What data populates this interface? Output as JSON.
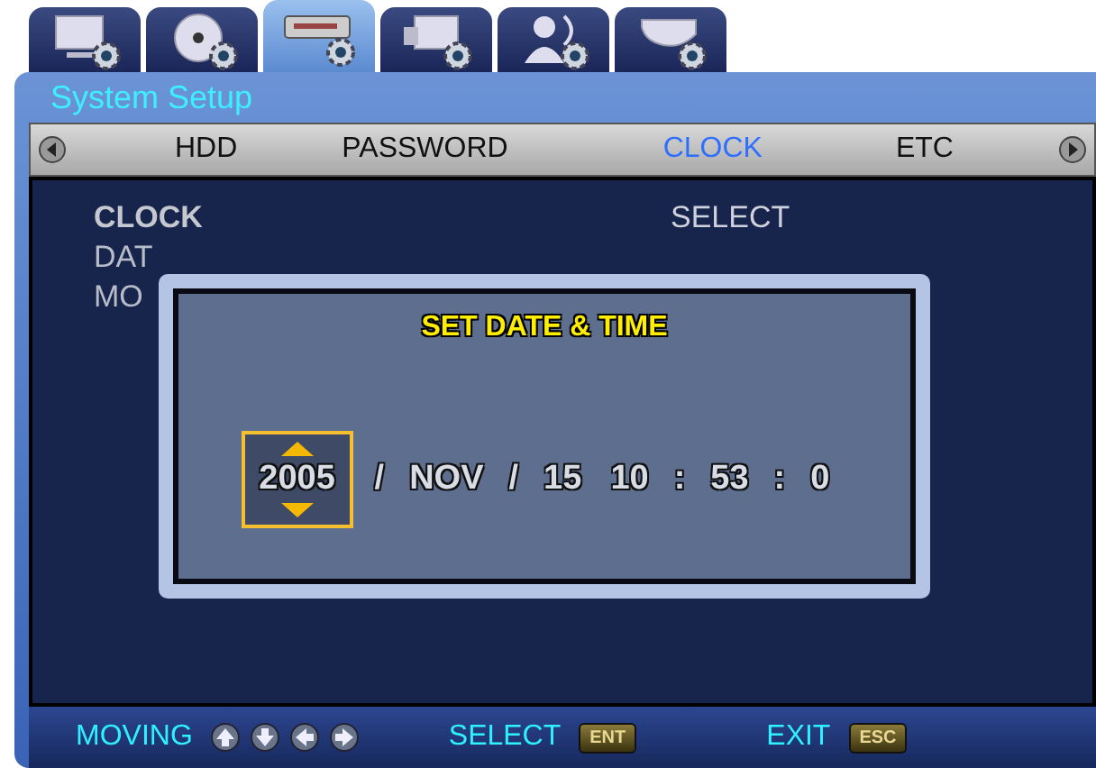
{
  "category_tabs": [
    {
      "selected": false
    },
    {
      "selected": false
    },
    {
      "selected": true
    },
    {
      "selected": false
    },
    {
      "selected": false
    },
    {
      "selected": false
    }
  ],
  "window": {
    "title": "System Setup"
  },
  "tabs": [
    {
      "label": "HDD",
      "selected": false
    },
    {
      "label": "PASSWORD",
      "selected": false
    },
    {
      "label": "CLOCK",
      "selected": true
    },
    {
      "label": "ETC",
      "selected": false
    }
  ],
  "background_rows": [
    {
      "label": "CLOCK",
      "value": "SELECT"
    },
    {
      "label": "DAT"
    },
    {
      "label": "MO"
    }
  ],
  "dialog": {
    "title": "SET DATE & TIME",
    "fields": [
      {
        "text": "2005",
        "selected": true
      },
      {
        "text": "/",
        "kind": "sep"
      },
      {
        "text": "NOV",
        "selected": false
      },
      {
        "text": "/",
        "kind": "sep"
      },
      {
        "text": "15",
        "selected": false
      },
      {
        "text": "10",
        "selected": false
      },
      {
        "text": ":",
        "kind": "sep"
      },
      {
        "text": "53",
        "selected": false
      },
      {
        "text": ":",
        "kind": "sep"
      },
      {
        "text": "0",
        "selected": false
      }
    ]
  },
  "footer": {
    "moving": "MOVING",
    "select": "SELECT",
    "select_key": "ENT",
    "exit": "EXIT",
    "exit_key": "ESC"
  }
}
